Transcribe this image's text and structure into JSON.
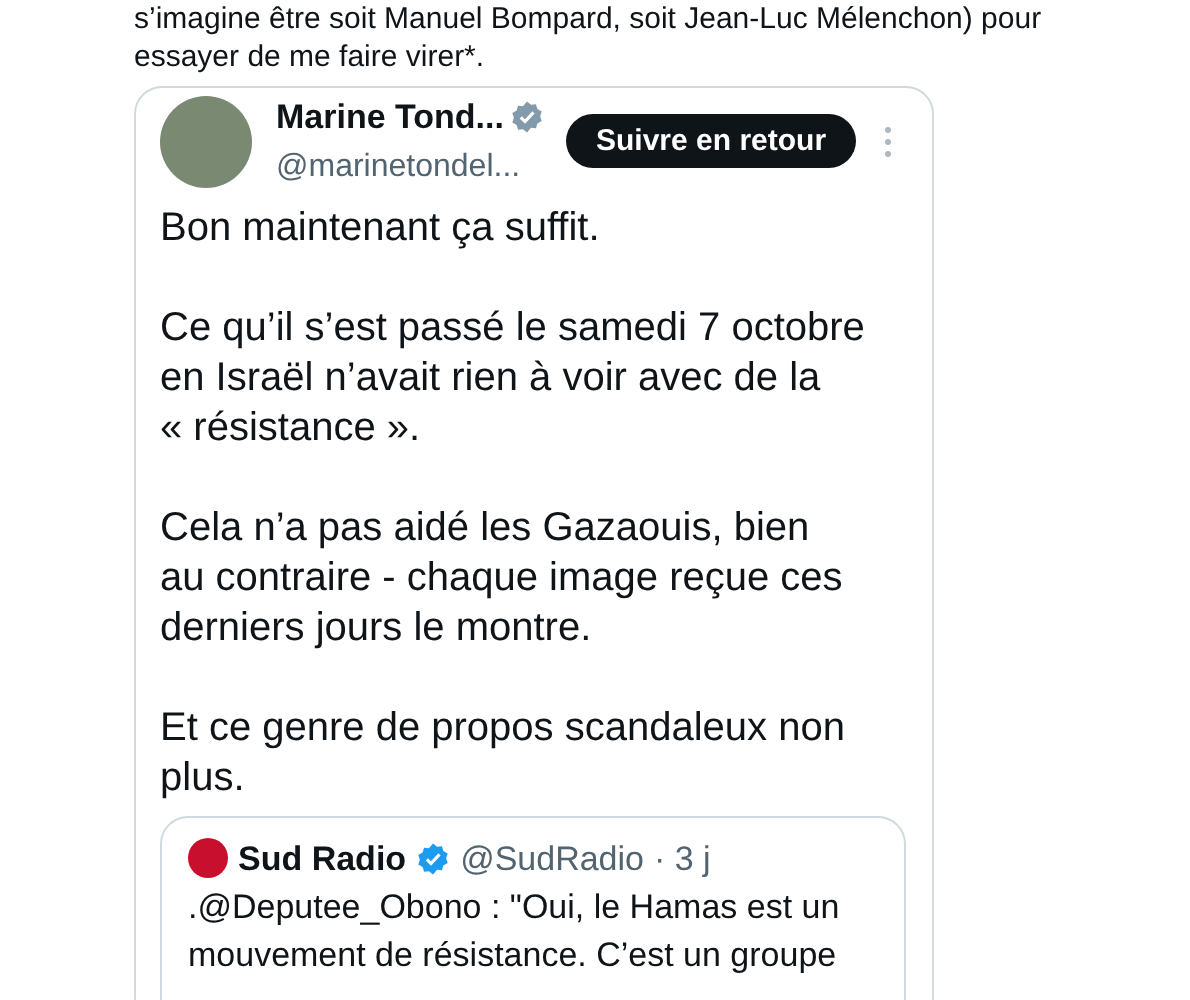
{
  "article": {
    "lines": [
      "s’imagine être soit Manuel Bompard, soit Jean-Luc Mélenchon) pour",
      "essayer de me faire virer*."
    ]
  },
  "tweet": {
    "author": {
      "name": "Marine Tond...",
      "verified": true,
      "handle": "@marinetondel..."
    },
    "follow_button": "Suivre en retour",
    "paragraphs": [
      [
        "Bon maintenant ça suffit."
      ],
      [
        "Ce qu’il s’est passé le samedi 7 octobre",
        "en Israël n’avait rien à voir avec de la",
        "« résistance »."
      ],
      [
        "Cela n’a pas aidé les Gazaouis, bien",
        "au contraire - chaque image reçue ces",
        "derniers jours le montre."
      ],
      [
        "Et ce genre de propos scandaleux non",
        "plus."
      ]
    ],
    "quoted": {
      "name": "Sud Radio",
      "verified": true,
      "handle": "@SudRadio",
      "time": "· 3 j",
      "lines": [
        ".@Deputee_Obono : \"Oui, le Hamas est un",
        "mouvement de résistance. C’est un groupe"
      ]
    }
  }
}
